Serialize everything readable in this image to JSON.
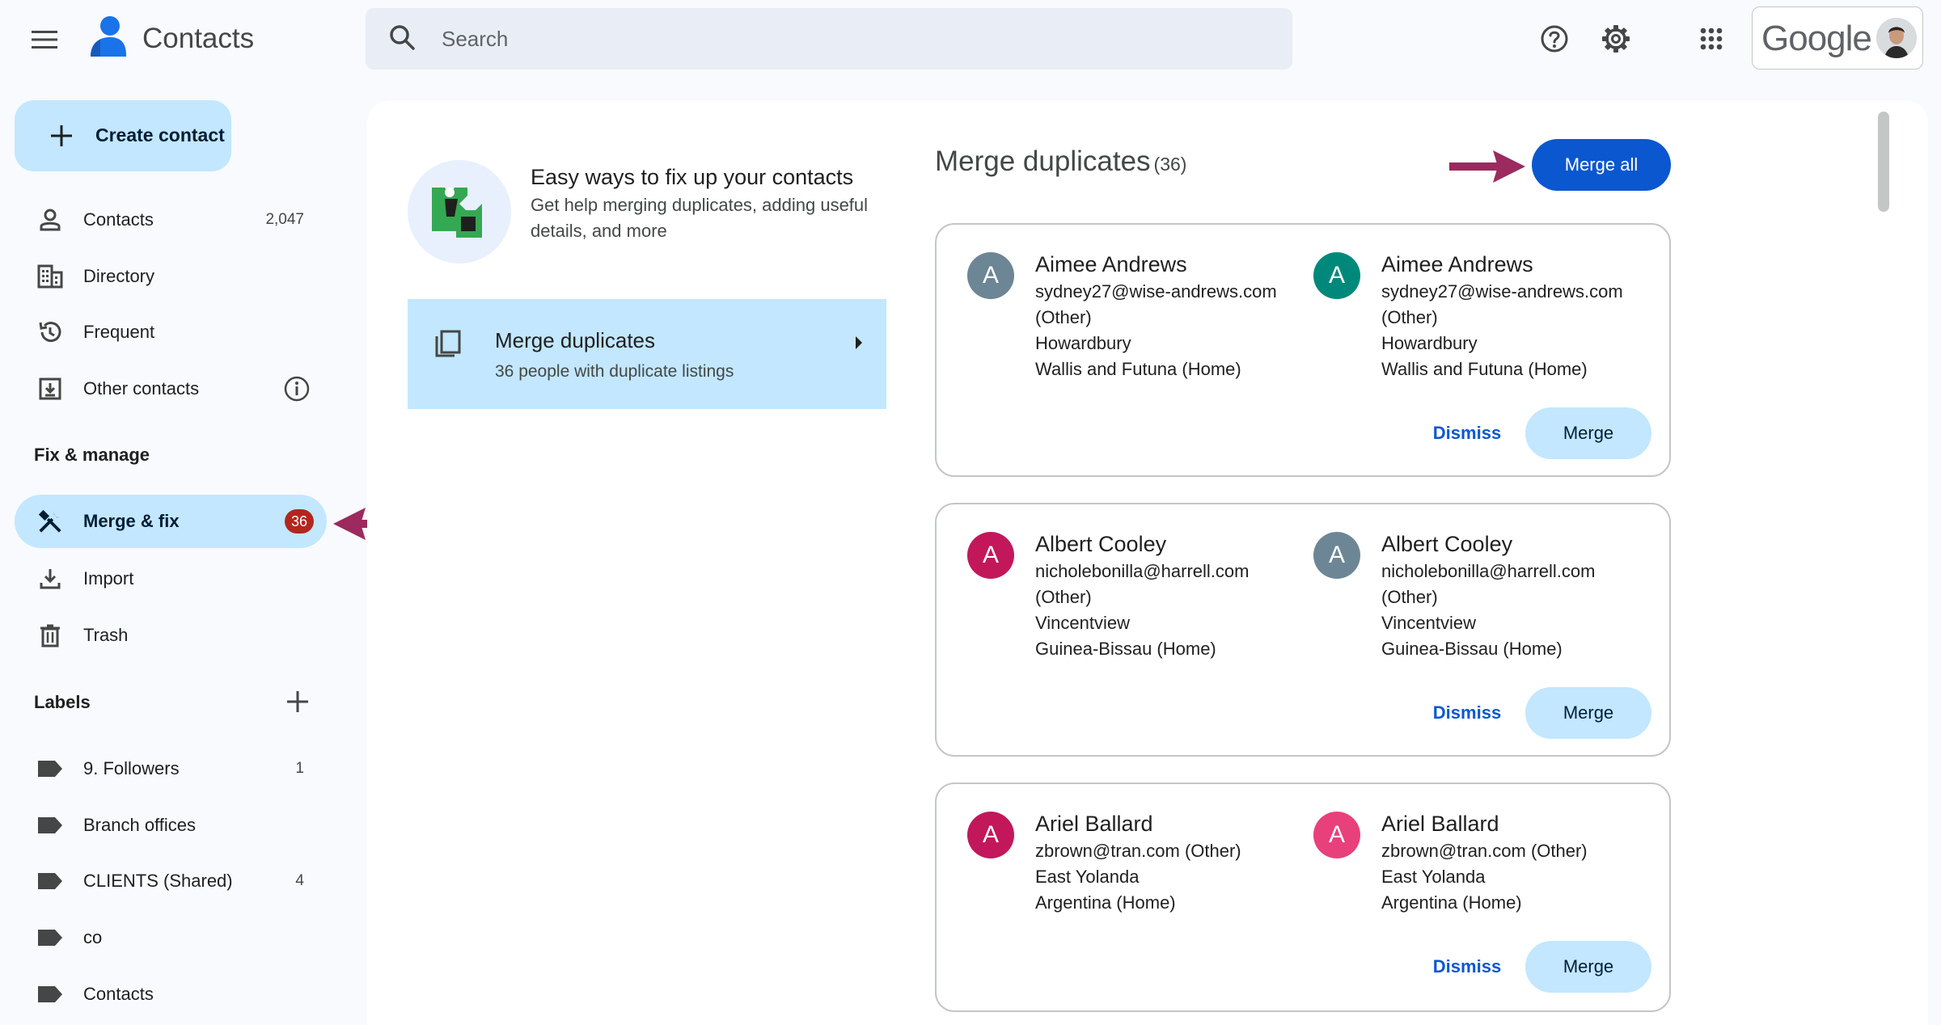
{
  "header": {
    "app_title": "Contacts",
    "search_placeholder": "Search",
    "brand": "Google",
    "icons": [
      "menu-icon",
      "contacts-logo-icon",
      "search-icon",
      "help-icon",
      "settings-icon",
      "apps-grid-icon"
    ]
  },
  "sidebar": {
    "create_label": "Create contact",
    "items": [
      {
        "label": "Contacts",
        "count": "2,047",
        "icon": "person-icon"
      },
      {
        "label": "Directory",
        "count": "",
        "icon": "building-icon"
      },
      {
        "label": "Frequent",
        "count": "",
        "icon": "history-icon"
      },
      {
        "label": "Other contacts",
        "count": "",
        "icon": "download-box-icon"
      }
    ],
    "fix_section_title": "Fix & manage",
    "fix_items": [
      {
        "label": "Merge & fix",
        "badge": "36",
        "icon": "tools-icon"
      },
      {
        "label": "Import",
        "icon": "import-icon"
      },
      {
        "label": "Trash",
        "icon": "trash-icon"
      }
    ],
    "labels_section_title": "Labels",
    "labels": [
      {
        "label": "9. Followers",
        "count": "1"
      },
      {
        "label": "Branch offices",
        "count": ""
      },
      {
        "label": "CLIENTS (Shared)",
        "count": "4"
      },
      {
        "label": "co",
        "count": ""
      },
      {
        "label": "Contacts",
        "count": ""
      }
    ]
  },
  "promo": {
    "title": "Easy ways to fix up your contacts",
    "description": "Get help merging duplicates, adding useful details, and more"
  },
  "merge_card": {
    "title": "Merge duplicates",
    "subtitle": "36 people with duplicate listings"
  },
  "duplicates": {
    "title": "Merge duplicates",
    "count": "(36)",
    "merge_all_label": "Merge all",
    "dismiss_label": "Dismiss",
    "merge_label": "Merge",
    "groups": [
      {
        "contacts": [
          {
            "initial": "A",
            "color": "#6d8696",
            "name": "Aimee Andrews",
            "lines": [
              "sydney27@wise-andrews.com",
              "(Other)",
              "Howardbury",
              "Wallis and Futuna (Home)"
            ]
          },
          {
            "initial": "A",
            "color": "#00897b",
            "name": "Aimee Andrews",
            "lines": [
              "sydney27@wise-andrews.com",
              "(Other)",
              "Howardbury",
              "Wallis and Futuna (Home)"
            ]
          }
        ]
      },
      {
        "contacts": [
          {
            "initial": "A",
            "color": "#c2185b",
            "name": "Albert Cooley",
            "lines": [
              "nicholebonilla@harrell.com",
              "(Other)",
              "Vincentview",
              "Guinea-Bissau (Home)"
            ]
          },
          {
            "initial": "A",
            "color": "#6d8696",
            "name": "Albert Cooley",
            "lines": [
              "nicholebonilla@harrell.com",
              "(Other)",
              "Vincentview",
              "Guinea-Bissau (Home)"
            ]
          }
        ]
      },
      {
        "contacts": [
          {
            "initial": "A",
            "color": "#c2185b",
            "name": "Ariel Ballard",
            "lines": [
              "zbrown@tran.com (Other)",
              "East Yolanda",
              "Argentina (Home)"
            ]
          },
          {
            "initial": "A",
            "color": "#e8407a",
            "name": "Ariel Ballard",
            "lines": [
              "zbrown@tran.com (Other)",
              "East Yolanda",
              "Argentina (Home)"
            ]
          }
        ]
      }
    ]
  },
  "colors": {
    "accent": "#0b57d0",
    "selection": "#c2e7ff",
    "badge": "#b3261e",
    "annotation_arrow": "#9c2a5e"
  }
}
